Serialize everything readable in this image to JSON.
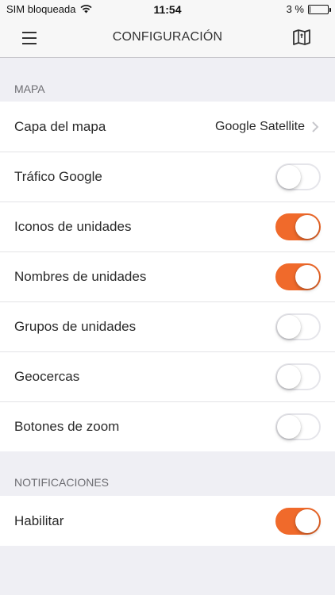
{
  "status": {
    "carrier": "SIM bloqueada",
    "time": "11:54",
    "battery": "3 %",
    "battery_level": 0.03
  },
  "nav": {
    "title": "CONFIGURACIÓN",
    "menu_icon": "hamburger-menu-icon",
    "map_icon": "map-icon"
  },
  "sections": [
    {
      "header": "MAPA",
      "rows": [
        {
          "label": "Capa del mapa",
          "value": "Google Satellite",
          "type": "link"
        },
        {
          "label": "Tráfico Google",
          "type": "toggle",
          "on": false
        },
        {
          "label": "Iconos de unidades",
          "type": "toggle",
          "on": true
        },
        {
          "label": "Nombres de unidades",
          "type": "toggle",
          "on": true
        },
        {
          "label": "Grupos de unidades",
          "type": "toggle",
          "on": false
        },
        {
          "label": "Geocercas",
          "type": "toggle",
          "on": false
        },
        {
          "label": "Botones de zoom",
          "type": "toggle",
          "on": false
        }
      ]
    },
    {
      "header": "NOTIFICACIONES",
      "rows": [
        {
          "label": "Habilitar",
          "type": "toggle",
          "on": true
        }
      ]
    }
  ],
  "colors": {
    "accent": "#f06a2b",
    "background": "#efeff4",
    "cell": "#ffffff"
  }
}
